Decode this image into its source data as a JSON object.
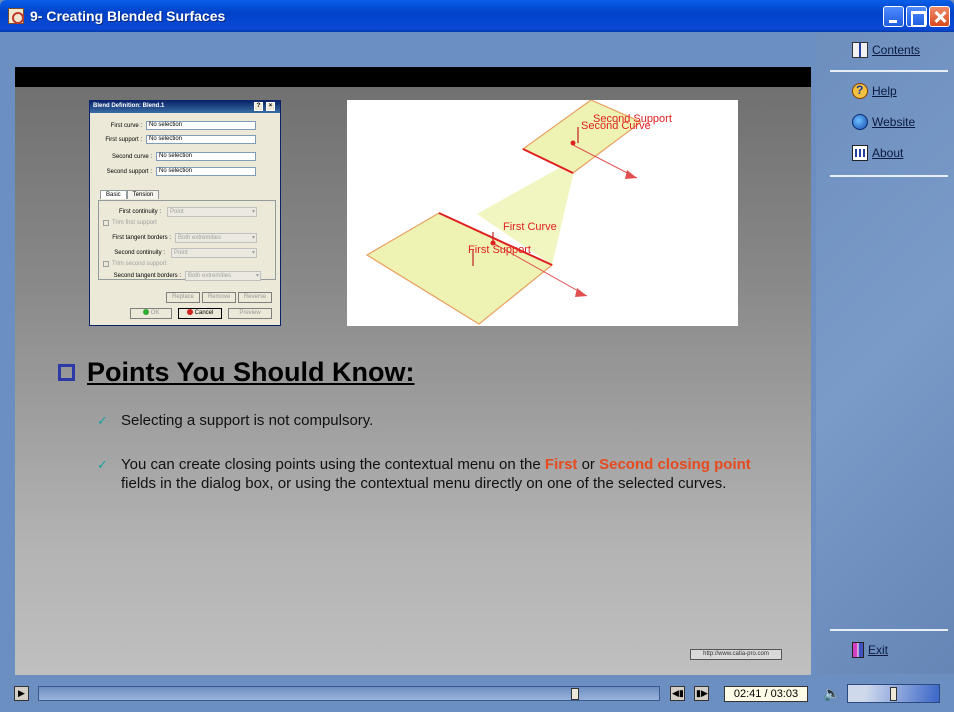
{
  "window": {
    "title": "9- Creating Blended Surfaces"
  },
  "dialog": {
    "title": "Blend Definition: Blend.1",
    "fields": [
      {
        "label": "First curve :",
        "value": "No selection"
      },
      {
        "label": "First support :",
        "value": "No selection"
      },
      {
        "label": "Second curve :",
        "value": "No selection"
      },
      {
        "label": "Second support :",
        "value": "No selection"
      }
    ],
    "tabs": [
      "Basic",
      "Tension"
    ],
    "first_continuity_label": "First continuity :",
    "first_continuity_value": "Point",
    "trim_first_label": "Trim first support",
    "first_tangent_label": "First tangent borders :",
    "first_tangent_value": "Both extremities",
    "second_continuity_label": "Second continuity :",
    "second_continuity_value": "Point",
    "trim_second_label": "Trim second support",
    "second_tangent_label": "Second tangent borders :",
    "second_tangent_value": "Both extremities",
    "btn_replace": "Replace",
    "btn_remove": "Remove",
    "btn_reverse": "Reverse",
    "btn_ok": "OK",
    "btn_cancel": "Cancel",
    "btn_preview": "Preview"
  },
  "diagram": {
    "label_second_support": "Second Support",
    "label_second_curve": "Second Curve",
    "label_first_curve": "First Curve",
    "label_first_support": "First Support",
    "colors": {
      "surface": "#eef3b4",
      "edge": "#e8a060",
      "label": "#e02020"
    }
  },
  "slide": {
    "heading": "Points You Should Know:",
    "bullets": {
      "b1": "Selecting a support is not compulsory.",
      "b2_part1": "You can create closing points using the contextual menu on the ",
      "b2_first": "First",
      "b2_or": " or ",
      "b2_second": "Second closing point",
      "b2_part2": " fields in the dialog box, or using the contextual menu directly on one of the selected curves."
    },
    "url": "http://www.catia-pro.com"
  },
  "side_menu": {
    "contents": "Contents",
    "help": "Help",
    "website": "Website",
    "about": "About",
    "exit": "Exit"
  },
  "player": {
    "time": "02:41 / 03:03",
    "progress": 0.87,
    "volume": 0.5
  }
}
